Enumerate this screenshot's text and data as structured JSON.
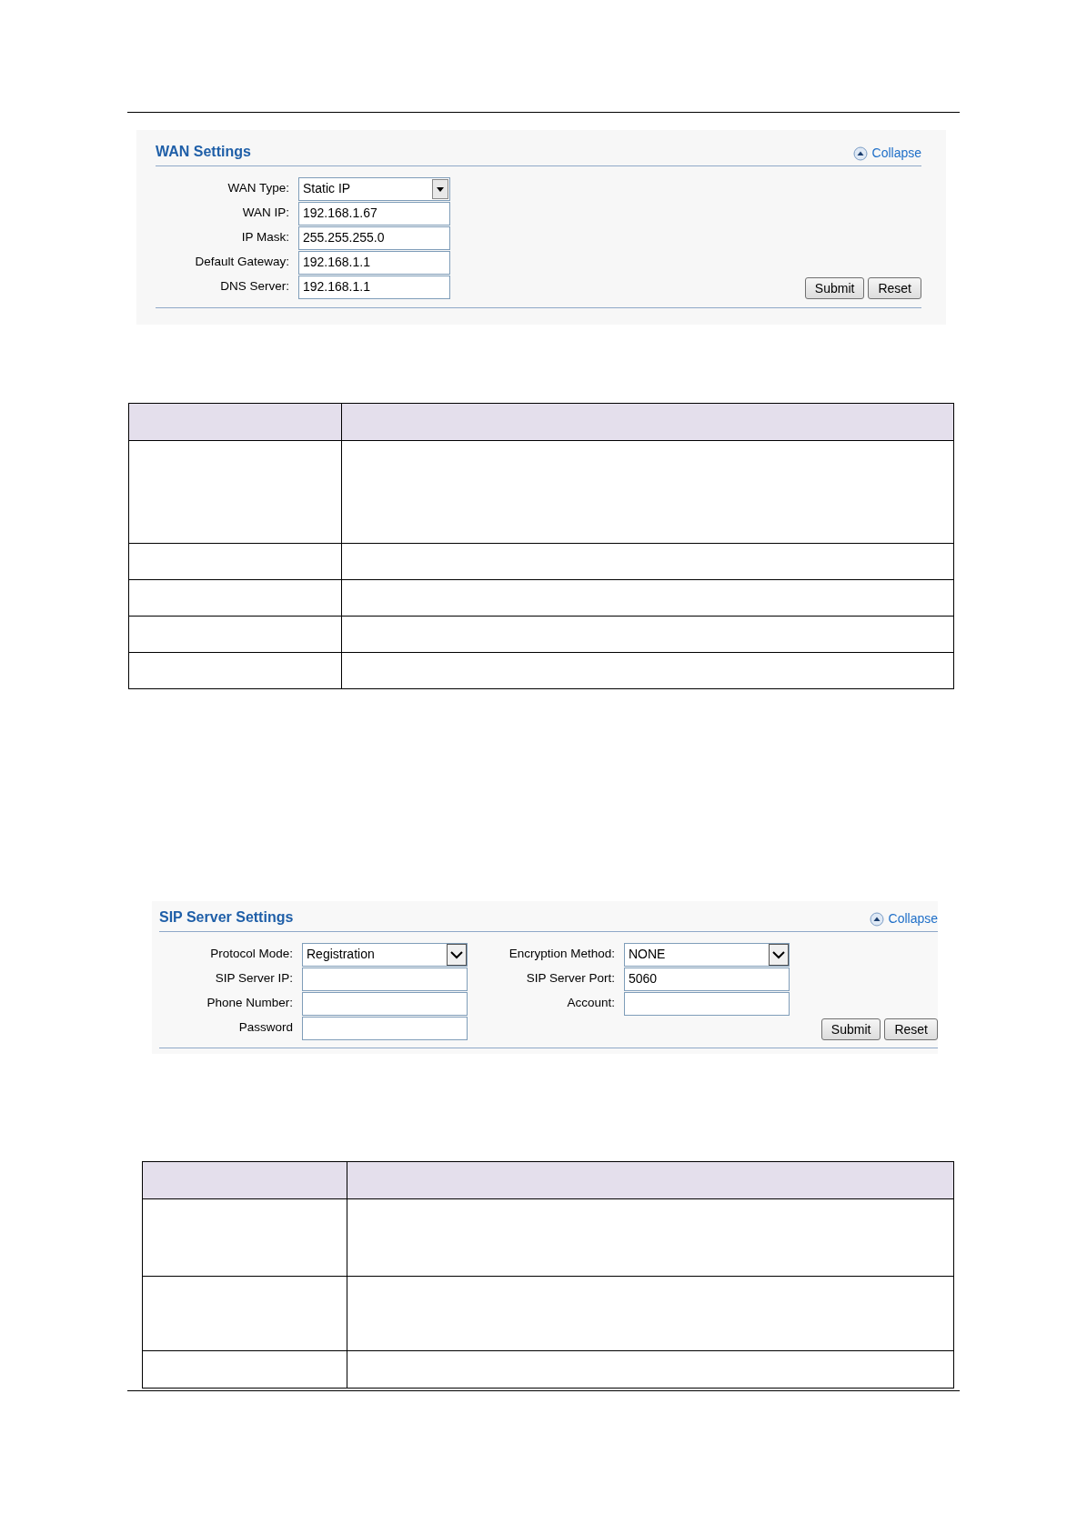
{
  "wan_settings": {
    "title": "WAN Settings",
    "collapse": "Collapse",
    "fields": [
      {
        "kind": "select",
        "label": "WAN Type:",
        "value": "Static IP"
      },
      {
        "kind": "text",
        "label": "WAN IP:",
        "value": "192.168.1.67"
      },
      {
        "kind": "text",
        "label": "IP Mask:",
        "value": "255.255.255.0"
      },
      {
        "kind": "text",
        "label": "Default Gateway:",
        "value": "192.168.1.1"
      },
      {
        "kind": "text",
        "label": "DNS Server:",
        "value": "192.168.1.1"
      }
    ],
    "buttons": [
      "Submit",
      "Reset"
    ]
  },
  "sip_server_settings": {
    "title": "SIP Server Settings",
    "collapse": "Collapse",
    "fields_left": [
      {
        "kind": "select",
        "label": "Protocol Mode:",
        "value": "Registration"
      },
      {
        "kind": "text",
        "label": "SIP Server IP:"
      },
      {
        "kind": "text",
        "label": "Phone Number:"
      },
      {
        "kind": "text",
        "label": "Password"
      }
    ],
    "fields_right": [
      {
        "kind": "select",
        "label": "Encryption Method:",
        "value": "NONE"
      },
      {
        "kind": "text",
        "label": "SIP Server Port:",
        "value": "5060"
      },
      {
        "kind": "text",
        "label": "Account:"
      }
    ],
    "buttons": [
      "Submit",
      "Reset"
    ]
  }
}
